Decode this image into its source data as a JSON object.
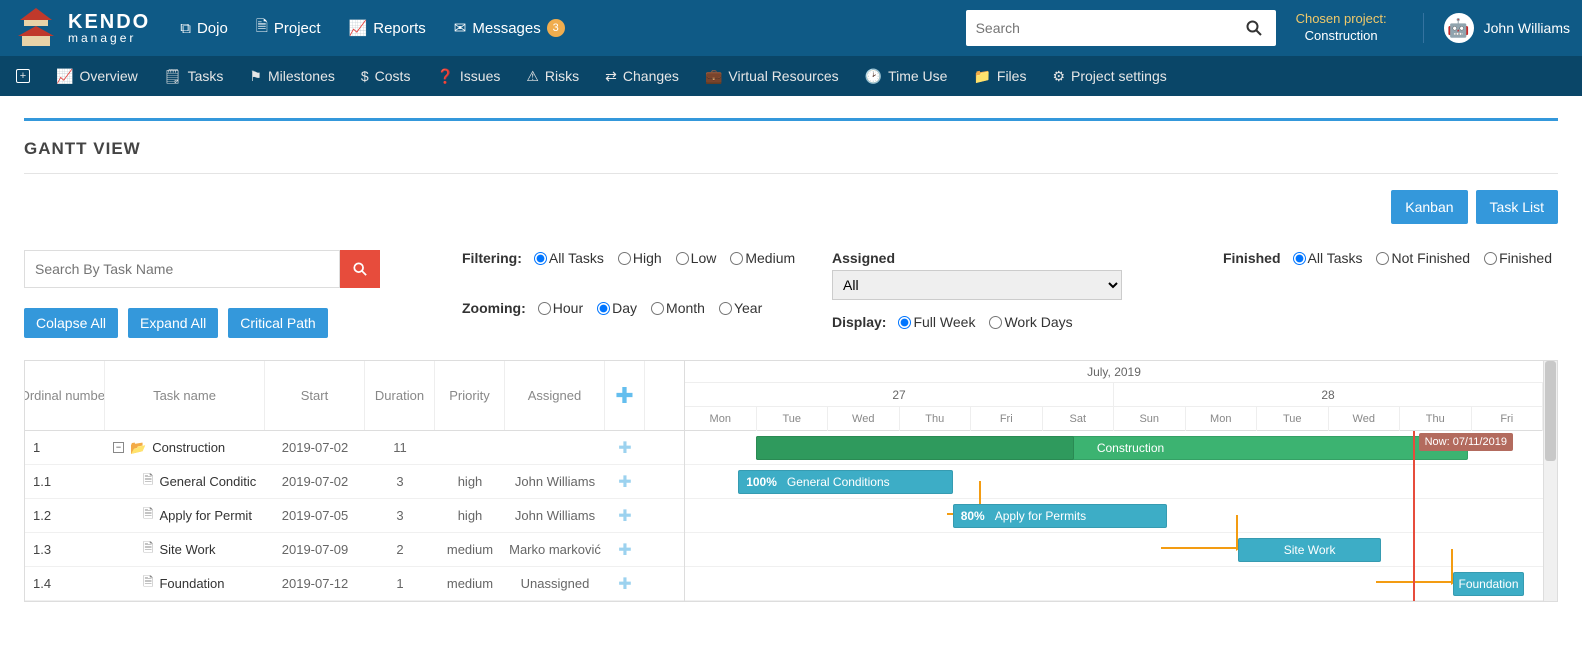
{
  "brand": {
    "name": "KENDO",
    "sub": "manager"
  },
  "topnav": {
    "dojo": "Dojo",
    "project": "Project",
    "reports": "Reports",
    "messages": "Messages",
    "messages_badge": "3"
  },
  "search": {
    "placeholder": "Search"
  },
  "chosen": {
    "label": "Chosen project:",
    "value": "Construction"
  },
  "user": {
    "name": "John Williams"
  },
  "subnav": {
    "overview": "Overview",
    "tasks": "Tasks",
    "milestones": "Milestones",
    "costs": "Costs",
    "issues": "Issues",
    "risks": "Risks",
    "changes": "Changes",
    "virtual": "Virtual Resources",
    "timeuse": "Time Use",
    "files": "Files",
    "settings": "Project settings"
  },
  "page": {
    "title": "GANTT VIEW",
    "kanban": "Kanban",
    "tasklist": "Task List"
  },
  "controls": {
    "task_search_placeholder": "Search By Task Name",
    "collapse": "Colapse All",
    "expand": "Expand All",
    "critical": "Critical Path",
    "filtering_label": "Filtering:",
    "filter_opts": {
      "all": "All Tasks",
      "high": "High",
      "low": "Low",
      "medium": "Medium"
    },
    "zoom_label": "Zooming:",
    "zoom_opts": {
      "hour": "Hour",
      "day": "Day",
      "month": "Month",
      "year": "Year"
    },
    "assigned_label": "Assigned",
    "assigned_value": "All",
    "display_label": "Display:",
    "display_opts": {
      "full": "Full Week",
      "work": "Work Days"
    },
    "finished_label": "Finished",
    "finished_opts": {
      "all": "All Tasks",
      "notfin": "Not Finished",
      "fin": "Finished"
    }
  },
  "table": {
    "headers": {
      "ord": "Ordinal number",
      "name": "Task name",
      "start": "Start",
      "dur": "Duration",
      "prio": "Priority",
      "asg": "Assigned"
    },
    "rows": [
      {
        "ord": "1",
        "name": "Construction",
        "start": "2019-07-02",
        "dur": "11",
        "prio": "",
        "asg": "",
        "parent": true
      },
      {
        "ord": "1.1",
        "name": "General Conditic",
        "start": "2019-07-02",
        "dur": "3",
        "prio": "high",
        "asg": "John Williams",
        "parent": false
      },
      {
        "ord": "1.2",
        "name": "Apply for Permit",
        "start": "2019-07-05",
        "dur": "3",
        "prio": "high",
        "asg": "John Williams",
        "parent": false
      },
      {
        "ord": "1.3",
        "name": "Site Work",
        "start": "2019-07-09",
        "dur": "2",
        "prio": "medium",
        "asg": "Marko marković",
        "parent": false
      },
      {
        "ord": "1.4",
        "name": "Foundation",
        "start": "2019-07-12",
        "dur": "1",
        "prio": "medium",
        "asg": "Unassigned",
        "parent": false
      }
    ]
  },
  "timeline": {
    "month": "July, 2019",
    "weeks": [
      "27",
      "28"
    ],
    "days": [
      "Mon",
      "Tue",
      "Wed",
      "Thu",
      "Fri",
      "Sat",
      "Sun",
      "Mon",
      "Tue",
      "Wed",
      "Thu",
      "Fri"
    ],
    "now_label": "Now: 07/11/2019",
    "bars": {
      "parent_pct": "45%",
      "parent_label": "Construction",
      "r1_pct": "100%",
      "r1_label": "General Conditions",
      "r2_pct": "80%",
      "r2_label": "Apply for Permits",
      "r3_label": "Site Work",
      "r4_label": "Foundation"
    }
  }
}
